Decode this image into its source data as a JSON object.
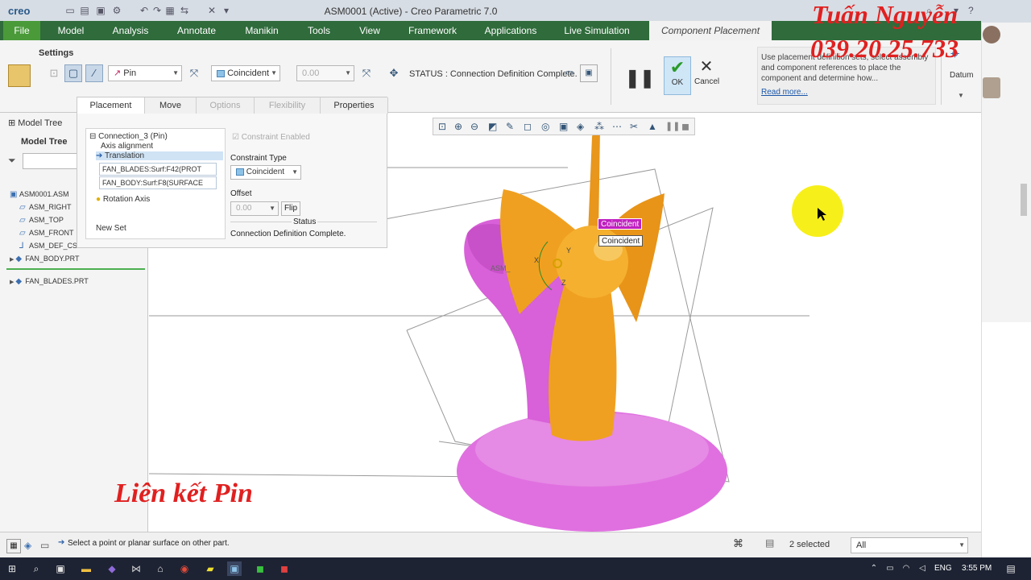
{
  "window": {
    "app_logo": "creo",
    "title": "ASM0001 (Active) - Creo Parametric 7.0"
  },
  "ribbon_tabs": [
    "File",
    "Model",
    "Analysis",
    "Annotate",
    "Manikin",
    "Tools",
    "View",
    "Framework",
    "Applications",
    "Live Simulation",
    "Component Placement"
  ],
  "settings": {
    "label": "Settings",
    "connection_type": "Pin",
    "constraint": "Coincident",
    "offset_value": "0.00",
    "status": "STATUS : Connection Definition Complete.",
    "ok_label": "OK",
    "cancel_label": "Cancel",
    "help_text": "Use placement definition sets, select assembly and component references to place the component and determine how...",
    "help_link": "Read more...",
    "datum_label": "Datum"
  },
  "panel": {
    "tabs": [
      "Placement",
      "Move",
      "Options",
      "Flexibility",
      "Properties"
    ],
    "connection": "Connection_3 (Pin)",
    "axis_alignment": "Axis alignment",
    "translation": "Translation",
    "ref1": "FAN_BLADES:Surf:F42(PROT",
    "ref2": "FAN_BODY:Surf:F8(SURFACE",
    "rotation_axis": "Rotation Axis",
    "new_set": "New Set",
    "constraint_enabled": "Constraint Enabled",
    "constraint_type_label": "Constraint Type",
    "constraint_type": "Coincident",
    "offset_label": "Offset",
    "offset_value": "0.00",
    "flip_label": "Flip",
    "status_label": "Status",
    "status_text": "Connection Definition Complete."
  },
  "model_tree": {
    "tab_label": "Model Tree",
    "header": "Model Tree",
    "items": [
      "ASM0001.ASM",
      "ASM_RIGHT",
      "ASM_TOP",
      "ASM_FRONT",
      "ASM_DEF_CS",
      "FAN_BODY.PRT",
      "FAN_BLADES.PRT"
    ]
  },
  "viewport": {
    "callout1": "Coincident",
    "callout2": "Coincident",
    "asm_label": "ASM_",
    "axis_x": "X",
    "axis_y": "Y",
    "axis_z": "Z"
  },
  "watermark": {
    "name": "Tuấn Nguyễn",
    "phone": "039.20.25.733",
    "caption": "Liên kết Pin"
  },
  "statusbar": {
    "message": "Select a point or planar surface on other part.",
    "selected": "2 selected",
    "filter": "All"
  },
  "taskbar": {
    "lang": "ENG",
    "time": "3:55 PM"
  },
  "colors": {
    "ribbon_green": "#2f6b3b",
    "file_green": "#4a9a3a",
    "fan_body": "#e070e0",
    "fan_blades": "#f0a020",
    "callout_magenta": "#c020c0",
    "watermark_red": "#e02020"
  }
}
